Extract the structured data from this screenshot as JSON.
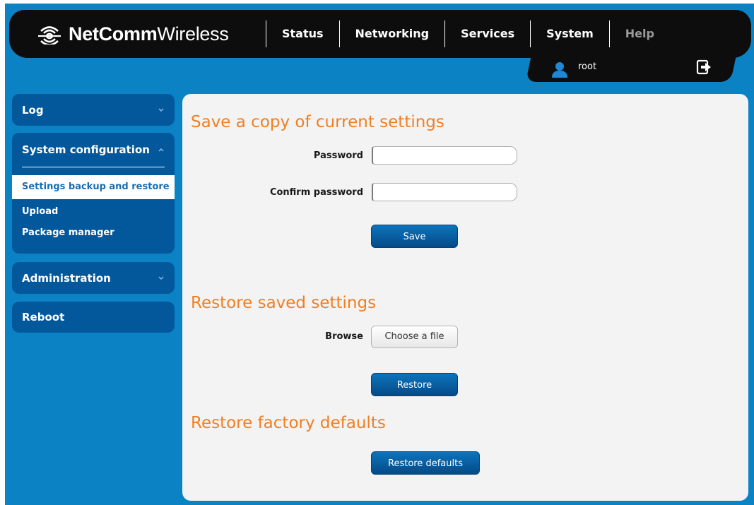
{
  "brand": {
    "name_bold": "NetComm",
    "name_regular": "Wireless"
  },
  "nav": {
    "items": [
      {
        "label": "Status"
      },
      {
        "label": "Networking"
      },
      {
        "label": "Services"
      },
      {
        "label": "System"
      },
      {
        "label": "Help"
      }
    ]
  },
  "user": {
    "name": "root"
  },
  "sidebar": {
    "log": "Log",
    "system_configuration": "System configuration",
    "sub_items": [
      {
        "label": "Settings backup and restore"
      },
      {
        "label": "Upload"
      },
      {
        "label": "Package manager"
      }
    ],
    "administration": "Administration",
    "reboot": "Reboot"
  },
  "main": {
    "save_section": {
      "title": "Save a copy of current settings",
      "password_label": "Password",
      "password_value": "",
      "confirm_label": "Confirm password",
      "confirm_value": "",
      "save_button": "Save"
    },
    "restore_section": {
      "title": "Restore saved settings",
      "browse_label": "Browse",
      "choose_file_button": "Choose a file",
      "restore_button": "Restore"
    },
    "factory_section": {
      "title": "Restore factory defaults",
      "restore_defaults_button": "Restore defaults"
    }
  },
  "colors": {
    "background_blue": "#0a82c4",
    "header_black": "#0d0d0d",
    "sidebar_blue": "#03589c",
    "accent_orange": "#f07f22",
    "panel_gray": "#f3f3f3"
  }
}
